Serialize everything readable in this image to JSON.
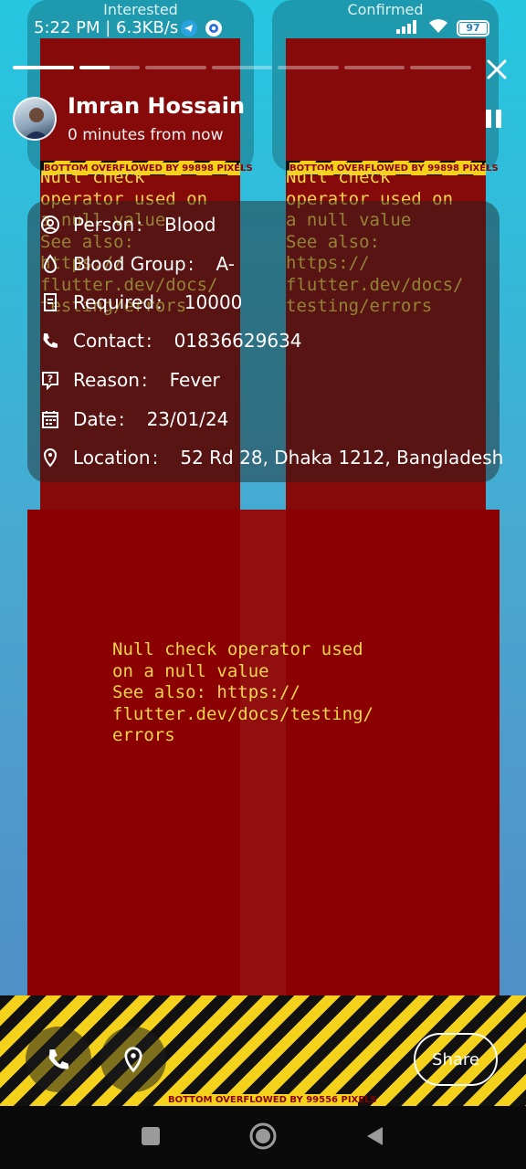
{
  "status_bar": {
    "time": "5:22 PM | 6.3KB/s",
    "battery": "97"
  },
  "pills": {
    "left_title": "Interested",
    "right_title": "Confirmed"
  },
  "story": {
    "segments_total": 7,
    "segments_progress": [
      1,
      0.5,
      0,
      0,
      0,
      0,
      0
    ]
  },
  "user": {
    "name": "Imran Hossain",
    "time": "0 minutes from now"
  },
  "details": [
    {
      "icon": "person-circle-icon",
      "label": "Person",
      "value": "Blood"
    },
    {
      "icon": "blood-drop-icon",
      "label": "Blood Group",
      "value": "A-"
    },
    {
      "icon": "receipt-icon",
      "label": "Required",
      "value": "10000"
    },
    {
      "icon": "phone-icon",
      "label": "Contact",
      "value": "01836629634"
    },
    {
      "icon": "question-icon",
      "label": "Reason",
      "value": "Fever"
    },
    {
      "icon": "calendar-icon",
      "label": "Date",
      "value": "23/01/24"
    },
    {
      "icon": "location-pin-icon",
      "label": "Location",
      "value": "52 Rd 28, Dhaka 1212, Bangladesh"
    }
  ],
  "errors": {
    "small_text": "Null check\noperator used on\na null value\nSee also:\nhttps://\nflutter.dev/docs/\ntesting/errors",
    "big_text": "Null check operator used\non a null value\nSee also: https://\nflutter.dev/docs/testing/\nerrors",
    "overflow_top": "BOTTOM OVERFLOWED BY 99898 PIXELS",
    "overflow_bottom": "BOTTOM OVERFLOWED BY 99556 PIXELS"
  },
  "actions": {
    "share_label": "Share"
  },
  "colors": {
    "error_red": "#870a0a",
    "error_text": "#f2d44a",
    "stripe_yellow": "#f4d21c"
  }
}
